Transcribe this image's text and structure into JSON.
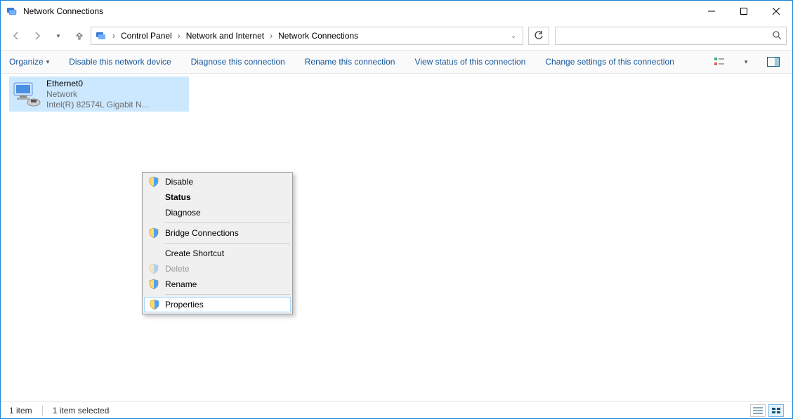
{
  "window": {
    "title": "Network Connections"
  },
  "breadcrumb": {
    "seg1": "Control Panel",
    "seg2": "Network and Internet",
    "seg3": "Network Connections"
  },
  "search": {
    "placeholder": ""
  },
  "cmdbar": {
    "organize": "Organize",
    "disable": "Disable this network device",
    "diagnose": "Diagnose this connection",
    "rename": "Rename this connection",
    "viewstatus": "View status of this connection",
    "changesettings": "Change settings of this connection"
  },
  "adapter": {
    "name": "Ethernet0",
    "status": "Network",
    "device": "Intel(R) 82574L Gigabit N..."
  },
  "context": {
    "disable": "Disable",
    "status": "Status",
    "diagnose": "Diagnose",
    "bridge": "Bridge Connections",
    "shortcut": "Create Shortcut",
    "delete": "Delete",
    "rename": "Rename",
    "properties": "Properties"
  },
  "statusbar": {
    "count": "1 item",
    "selected": "1 item selected"
  }
}
